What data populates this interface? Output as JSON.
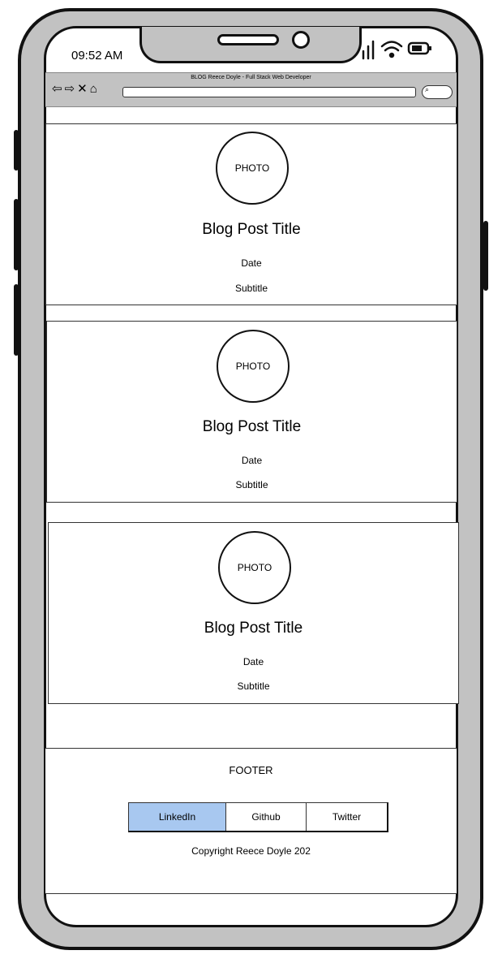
{
  "status_bar": {
    "time": "09:52 AM"
  },
  "browser": {
    "title": "BLOG Reece Doyle - Full Stack Web Developer",
    "nav_icons": "⇦⇨✕⌂",
    "search_icon": "⌕"
  },
  "posts": [
    {
      "photo": "PHOTO",
      "title": "Blog Post Title",
      "date": "Date",
      "subtitle": "Subtitle"
    },
    {
      "photo": "PHOTO",
      "title": "Blog Post Title",
      "date": "Date",
      "subtitle": "Subtitle"
    },
    {
      "photo": "PHOTO",
      "title": "Blog Post Title",
      "date": "Date",
      "subtitle": "Subtitle"
    }
  ],
  "footer": {
    "label": "FOOTER",
    "links": [
      "LinkedIn",
      "Github",
      "Twitter"
    ],
    "active_link": "LinkedIn",
    "copyright": "Copyright Reece Doyle 202"
  },
  "colors": {
    "phone_frame": "#c2c2c2",
    "active_link": "#a8c8f0"
  }
}
